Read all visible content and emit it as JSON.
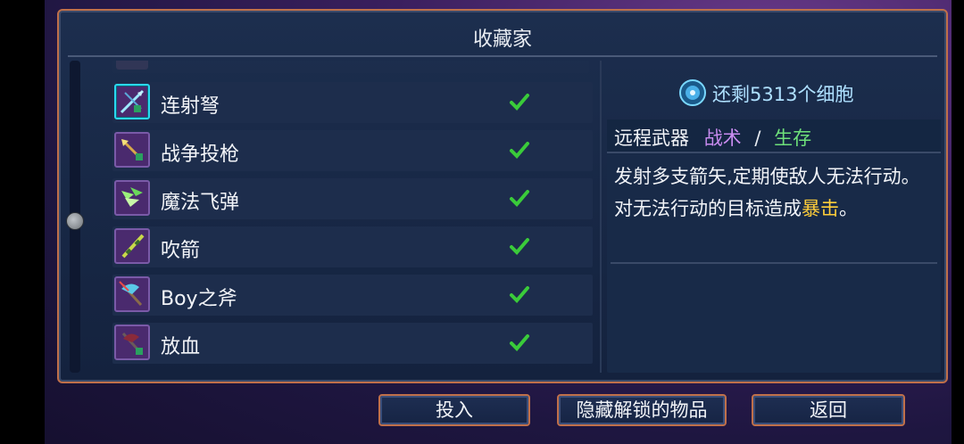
{
  "panel": {
    "title": "收藏家"
  },
  "cells": {
    "text": "还剩5313个细胞",
    "icon": "cell-orb-icon"
  },
  "items": [
    {
      "label": "连射弩",
      "icon": "repeater-crossbow-icon",
      "selected": true,
      "unlocked": true
    },
    {
      "label": "战争投枪",
      "icon": "war-javelin-icon",
      "selected": false,
      "unlocked": true
    },
    {
      "label": "魔法飞弹",
      "icon": "magic-missiles-icon",
      "selected": false,
      "unlocked": true
    },
    {
      "label": "吹箭",
      "icon": "blowgun-icon",
      "selected": false,
      "unlocked": true
    },
    {
      "label": "Boy之斧",
      "icon": "boy-axe-icon",
      "selected": false,
      "unlocked": true
    },
    {
      "label": "放血",
      "icon": "bloodletting-icon",
      "selected": false,
      "unlocked": true
    }
  ],
  "info": {
    "weapon_type": "远程武器",
    "tag_tactic": "战术",
    "tag_separator": "/",
    "tag_survival": "生存",
    "desc_main": "发射多支箭矢,定期使敌人无法行动。对无法行动的目标造成",
    "desc_crit": "暴击",
    "desc_end": "。"
  },
  "buttons": {
    "invest": "投入",
    "hide_unlocked": "隐藏解锁的物品",
    "back": "返回"
  },
  "colors": {
    "tactic": "#c98cf0",
    "survival": "#6ee07a",
    "crit": "#ffce3a",
    "border": "#c0704a",
    "check": "#3acb3a"
  }
}
